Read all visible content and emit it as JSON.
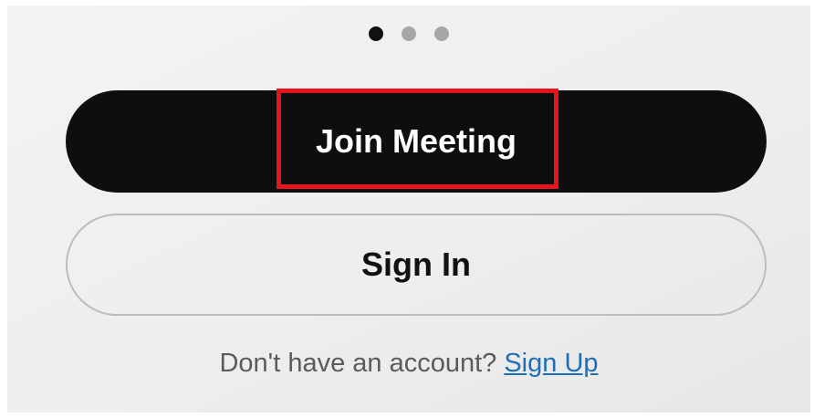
{
  "pager": {
    "total": 3,
    "active_index": 0
  },
  "buttons": {
    "join_meeting": "Join Meeting",
    "sign_in": "Sign In"
  },
  "signup": {
    "prompt": "Don't have an account?",
    "link": "Sign Up"
  },
  "colors": {
    "join_background": "#0e0e0e",
    "link": "#1f6fb8",
    "highlight_box": "#e8141b"
  }
}
